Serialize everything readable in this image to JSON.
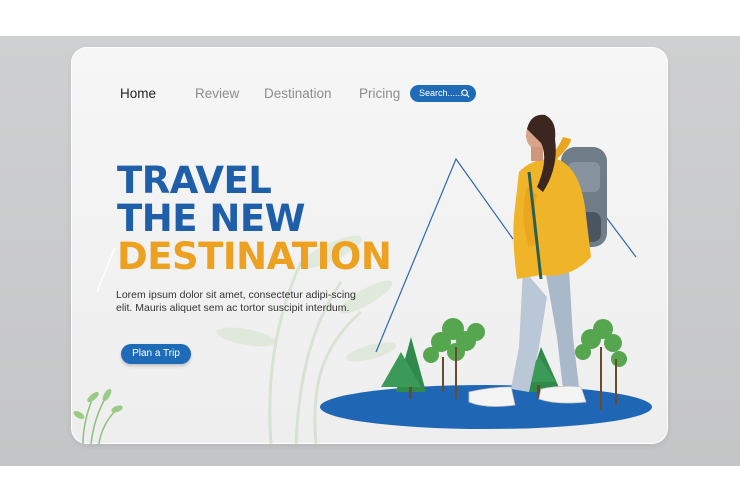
{
  "nav": {
    "items": [
      {
        "label": "Home",
        "active": true
      },
      {
        "label": "Review",
        "active": false
      },
      {
        "label": "Destination",
        "active": false
      },
      {
        "label": "Pricing",
        "active": false
      }
    ],
    "search_placeholder": "Search......",
    "search_icon": "search-icon"
  },
  "hero": {
    "line1": "TRAVEL",
    "line2": "THE NEW",
    "line3": "DESTINATION",
    "description": "Lorem ipsum dolor sit amet, consectetur adipi-scing elit. Mauris aliquet sem ac tortor suscipit interdum.",
    "cta_label": "Plan a Trip"
  },
  "colors": {
    "brand_blue": "#1e6bb8",
    "title_blue": "#1f5ea8",
    "accent_orange": "#eda121",
    "jacket_yellow": "#f0b429"
  }
}
